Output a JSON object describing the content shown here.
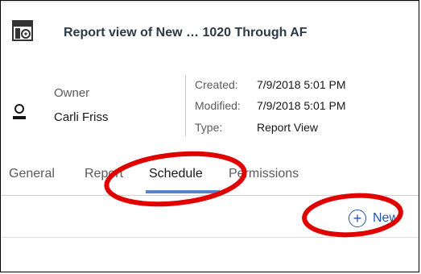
{
  "header": {
    "title": "Report view of New … 1020 Through AF",
    "icon": "report-view-icon"
  },
  "owner": {
    "label": "Owner",
    "name": "Carli Friss",
    "icon": "user-icon"
  },
  "meta": {
    "created_label": "Created:",
    "created_value": "7/9/2018 5:01 PM",
    "modified_label": "Modified:",
    "modified_value": "7/9/2018 5:01 PM",
    "type_label": "Type:",
    "type_value": "Report View"
  },
  "tabs": [
    {
      "label": "General"
    },
    {
      "label": "Report"
    },
    {
      "label": "Schedule",
      "selected": true
    },
    {
      "label": "Permissions"
    }
  ],
  "toolbar": {
    "new_label": "New",
    "new_icon": "add-circle-icon"
  },
  "colors": {
    "accent": "#5b82c6",
    "link": "#2554a7",
    "annotation": "#e00000"
  }
}
